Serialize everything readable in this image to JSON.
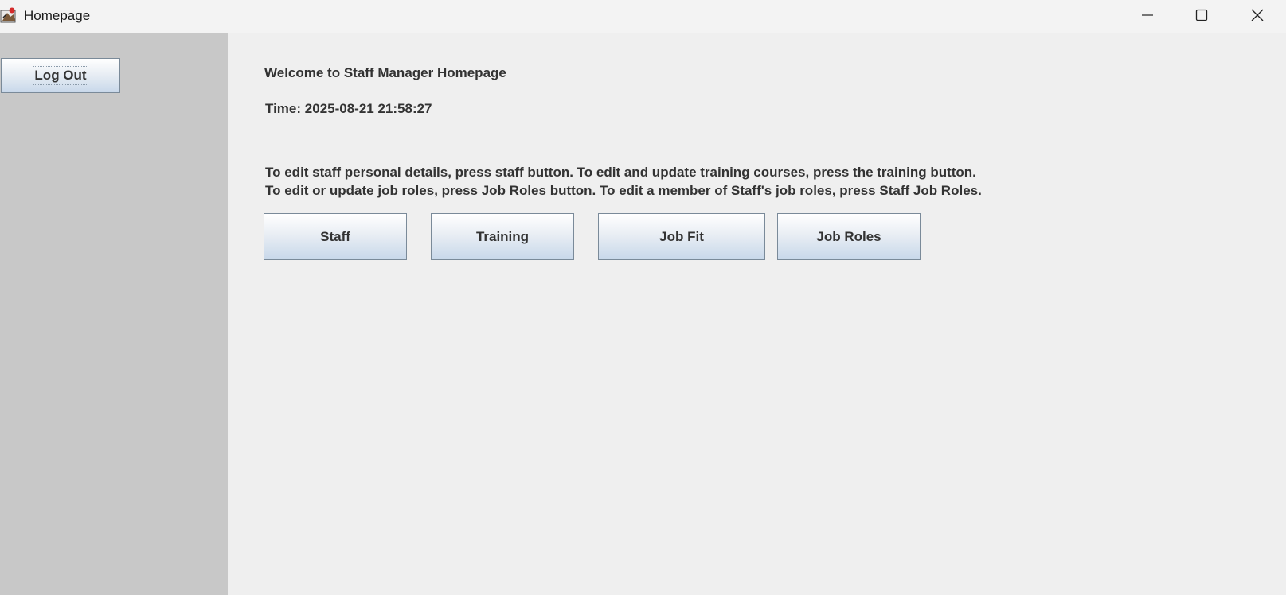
{
  "window": {
    "title": "Homepage",
    "icon": "java-app-icon",
    "controls": [
      "minimize-icon",
      "maximize-icon",
      "close-icon"
    ]
  },
  "sidebar": {
    "logout_label": "Log Out"
  },
  "main": {
    "welcome": "Welcome to Staff Manager Homepage",
    "time_label": "Time:",
    "time_value": "2025-08-21 21:58:27",
    "instruction_line1": "To edit staff personal details, press staff button. To edit and update training courses, press the training button.",
    "instruction_line2": "To edit or update job roles, press Job Roles button. To edit a member of Staff's job roles, press Staff Job Roles.",
    "buttons": {
      "staff": "Staff",
      "training": "Training",
      "job_fit": "Job Fit",
      "job_roles": "Job Roles"
    }
  },
  "colors": {
    "sidebar_bg": "#c8c8c8",
    "main_bg": "#efefef",
    "button_gradient_top": "#ffffff",
    "button_gradient_bottom": "#c8d8ea",
    "button_border": "#7a8a99",
    "text": "#333333"
  }
}
